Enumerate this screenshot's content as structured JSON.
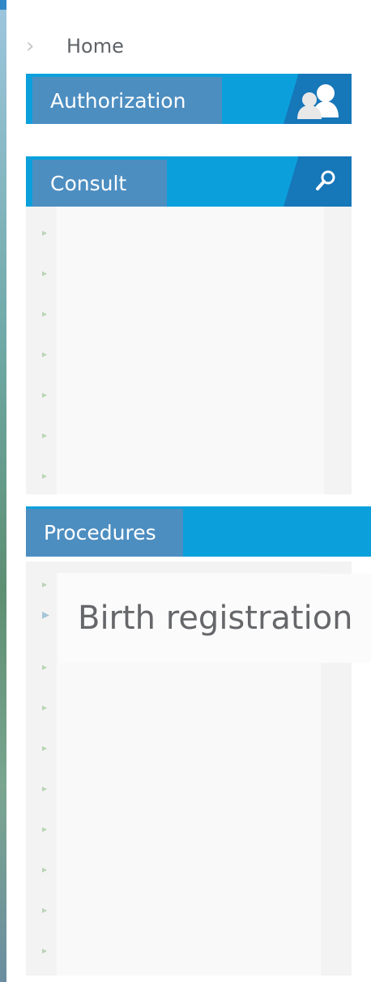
{
  "breadcrumb": {
    "home_label": "Home"
  },
  "sections": {
    "authorization": {
      "title": "Authorization",
      "icon": "users-icon"
    },
    "consult": {
      "title": "Consult",
      "icon": "search-icon",
      "items_count": 7
    },
    "procedures": {
      "title": "Procedures",
      "tooltip": "Birth registration",
      "items_count": 10
    }
  },
  "colors": {
    "header_bg": "#0ba0dc",
    "label_bg": "#4d8ec1",
    "stripe": "#1677b9"
  }
}
